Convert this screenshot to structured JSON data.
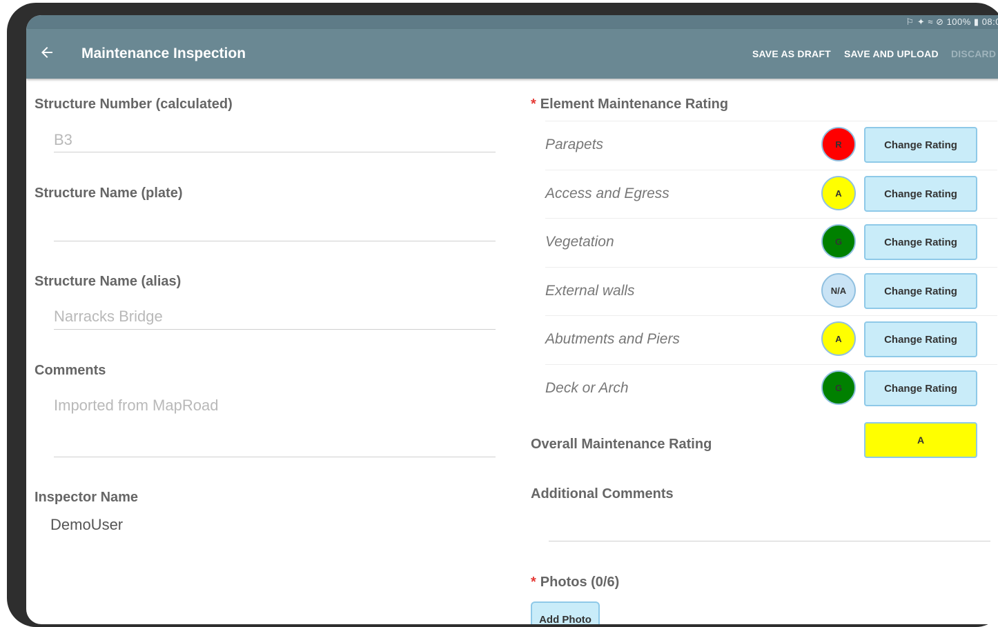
{
  "statusbar": {
    "text": "⚐ ✦ ≈ ⊘ 100% ▮ 08:0"
  },
  "appbar": {
    "title": "Maintenance Inspection",
    "actions": {
      "save_draft": "SAVE AS DRAFT",
      "save_upload": "SAVE AND UPLOAD",
      "discard": "DISCARD"
    }
  },
  "left": {
    "structure_number": {
      "label": "Structure Number (calculated)",
      "value": "B3"
    },
    "structure_name_plate": {
      "label": "Structure Name (plate)",
      "value": ""
    },
    "structure_name_alias": {
      "label": "Structure Name (alias)",
      "value": "Narracks Bridge"
    },
    "comments": {
      "label": "Comments",
      "value": "Imported from MapRoad"
    },
    "inspector": {
      "label": "Inspector Name",
      "value": "DemoUser"
    }
  },
  "element_rating": {
    "required_mark": "*",
    "label": "Element Maintenance Rating",
    "button_label": "Change Rating",
    "rows": [
      {
        "name": "Parapets",
        "rating": "R",
        "color": "#ff0000"
      },
      {
        "name": "Access and Egress",
        "rating": "A",
        "color": "#ffff00"
      },
      {
        "name": "Vegetation",
        "rating": "G",
        "color": "#008000"
      },
      {
        "name": "External walls",
        "rating": "N/A",
        "color": "#c9e3f5"
      },
      {
        "name": "Abutments and Piers",
        "rating": "A",
        "color": "#ffff00"
      },
      {
        "name": "Deck or Arch",
        "rating": "G",
        "color": "#008000"
      }
    ]
  },
  "overall": {
    "label": "Overall Maintenance Rating",
    "value": "A",
    "color": "#ffff00"
  },
  "additional_comments": {
    "label": "Additional Comments",
    "value": ""
  },
  "photos": {
    "required_mark": "*",
    "label": "Photos (0/6)",
    "button": "Add Photo"
  }
}
